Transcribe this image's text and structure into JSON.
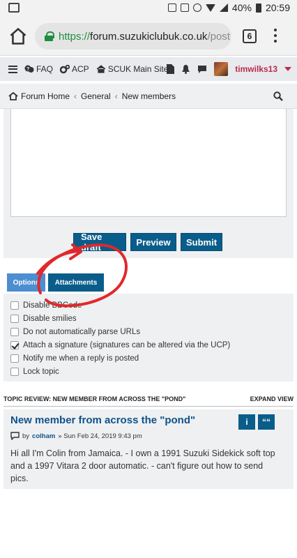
{
  "status_bar": {
    "battery": "40%",
    "time": "20:59"
  },
  "browser": {
    "url_scheme": "https://",
    "url_host": "forum.suzukiclubuk.co.uk",
    "url_path": "/post",
    "tab_count": "6"
  },
  "nav": {
    "faq": "FAQ",
    "acp": "ACP",
    "main_site": "SCUK Main Site",
    "username": "timwilks13"
  },
  "breadcrumbs": [
    "Forum Home",
    "General",
    "New members"
  ],
  "editor": {
    "save_draft": "Save draft",
    "preview": "Preview",
    "submit": "Submit"
  },
  "tabs": {
    "options": "Options",
    "attachments": "Attachments"
  },
  "options": [
    {
      "label": "Disable BBCode",
      "checked": false
    },
    {
      "label": "Disable smilies",
      "checked": false
    },
    {
      "label": "Do not automatically parse URLs",
      "checked": false
    },
    {
      "label": "Attach a signature (signatures can be altered via the UCP)",
      "checked": true
    },
    {
      "label": "Notify me when a reply is posted",
      "checked": false
    },
    {
      "label": "Lock topic",
      "checked": false
    }
  ],
  "review": {
    "heading": "TOPIC REVIEW: NEW MEMBER FROM ACROSS THE \"POND\"",
    "expand": "EXPAND VIEW",
    "post_title": "New member from across the \"pond\"",
    "by": "by",
    "author": "colham",
    "date": "» Sun Feb 24, 2019 9:43 pm",
    "body": "Hi all I'm Colin from Jamaica. - I own a 1991 Suzuki Sidekick soft top and a 1997 Vitara 2 door automatic. - can't figure out how to send pics.",
    "info_btn": "i",
    "quote_btn": "““"
  },
  "colors": {
    "button": "#0a5d8a",
    "accent_red": "#bc2a4d",
    "link": "#105289",
    "annotation": "#e0282c"
  }
}
